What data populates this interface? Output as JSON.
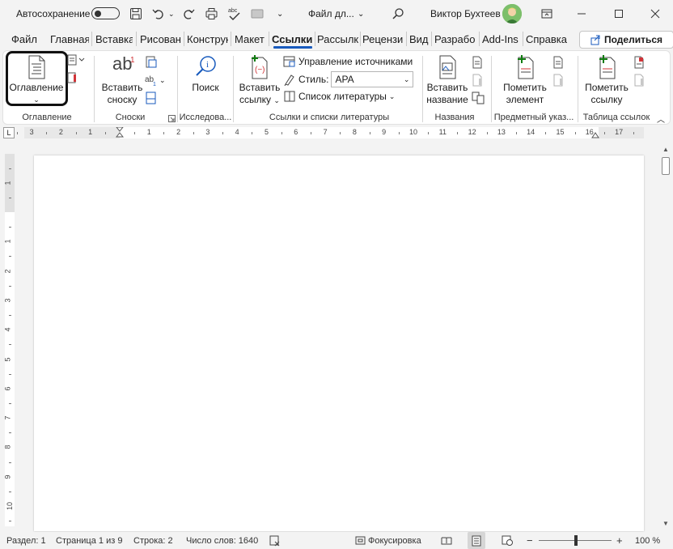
{
  "titlebar": {
    "autosave_label": "Автосохранение",
    "document_title": "Файл дл...",
    "user_name": "Виктор Бухтеев"
  },
  "tabs": [
    {
      "label": "Файл"
    },
    {
      "label": "Главная"
    },
    {
      "label": "Вставка"
    },
    {
      "label": "Рисован"
    },
    {
      "label": "Конструк"
    },
    {
      "label": "Макет"
    },
    {
      "label": "Ссылки",
      "active": true
    },
    {
      "label": "Рассылк"
    },
    {
      "label": "Рецензи"
    },
    {
      "label": "Вид"
    },
    {
      "label": "Разрабо"
    },
    {
      "label": "Add-Ins"
    },
    {
      "label": "Справка"
    }
  ],
  "share_label": "Поделиться",
  "ribbon": {
    "toc": {
      "button_label": "Оглавление",
      "group_label": "Оглавление"
    },
    "footnotes": {
      "insert_label_1": "Вставить",
      "insert_label_2": "сноску",
      "group_label": "Сноски",
      "ab_text": "ab",
      "sup_text": "1"
    },
    "research": {
      "search_label": "Поиск",
      "group_label": "Исследова..."
    },
    "citations": {
      "insert_label_1": "Вставить",
      "insert_label_2": "ссылку",
      "manage_sources": "Управление источниками",
      "style_label": "Стиль:",
      "style_value": "APA",
      "bibliography": "Список литературы",
      "group_label": "Ссылки и списки литературы"
    },
    "captions": {
      "insert_label_1": "Вставить",
      "insert_label_2": "название",
      "group_label": "Названия"
    },
    "index": {
      "mark_label_1": "Пометить",
      "mark_label_2": "элемент",
      "group_label": "Предметный указ..."
    },
    "table_auth": {
      "mark_label_1": "Пометить",
      "mark_label_2": "ссылку",
      "group_label": "Таблица ссылок"
    }
  },
  "ruler": {
    "corner": "L",
    "numbers": [
      "3",
      "2",
      "1",
      "1",
      "2",
      "3",
      "4",
      "5",
      "6",
      "7",
      "8",
      "9",
      "10",
      "11",
      "12",
      "13",
      "14",
      "15",
      "16",
      "17"
    ],
    "vnumbers": [
      "2",
      "1",
      "1",
      "2",
      "3",
      "4",
      "5",
      "6",
      "7",
      "8",
      "9",
      "10"
    ]
  },
  "status": {
    "section": "Раздел: 1",
    "page": "Страница 1 из 9",
    "line": "Строка: 2",
    "words": "Число слов: 1640",
    "focus": "Фокусировка",
    "zoom_minus": "−",
    "zoom_plus": "+",
    "zoom": "100 %"
  },
  "colors": {
    "accent": "#185abd",
    "ribbon_bg": "#ffffff",
    "chrome_bg": "#f3f3f3",
    "red_icon": "#d13438",
    "green_icon": "#107c10"
  }
}
